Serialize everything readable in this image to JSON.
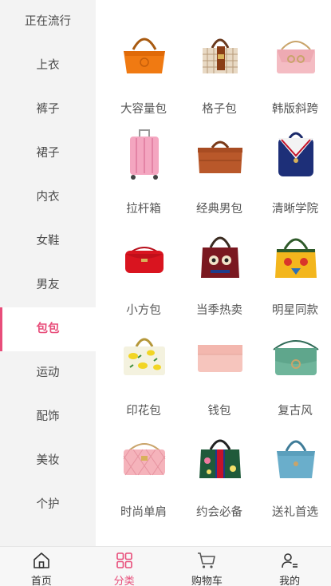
{
  "sidebar": {
    "items": [
      {
        "label": "正在流行"
      },
      {
        "label": "上衣"
      },
      {
        "label": "裤子"
      },
      {
        "label": "裙子"
      },
      {
        "label": "内衣"
      },
      {
        "label": "女鞋"
      },
      {
        "label": "男友"
      },
      {
        "label": "包包"
      },
      {
        "label": "运动"
      },
      {
        "label": "配饰"
      },
      {
        "label": "美妆"
      },
      {
        "label": "个护"
      }
    ],
    "active_label": "包包"
  },
  "grid": {
    "items": [
      {
        "label": "大容量包",
        "icon": "orange-handbag-icon"
      },
      {
        "label": "格子包",
        "icon": "plaid-bag-icon"
      },
      {
        "label": "韩版斜跨",
        "icon": "pink-crossbody-bag-icon"
      },
      {
        "label": "拉杆箱",
        "icon": "pink-suitcase-icon"
      },
      {
        "label": "经典男包",
        "icon": "brown-briefcase-icon"
      },
      {
        "label": "清晰学院",
        "icon": "navy-backpack-icon"
      },
      {
        "label": "小方包",
        "icon": "red-shoulder-bag-icon"
      },
      {
        "label": "当季热卖",
        "icon": "patterned-handbag-icon"
      },
      {
        "label": "明星同款",
        "icon": "yellow-embroidered-bag-icon"
      },
      {
        "label": "印花包",
        "icon": "lemon-print-bag-icon"
      },
      {
        "label": "钱包",
        "icon": "pink-wallet-icon"
      },
      {
        "label": "复古风",
        "icon": "green-saddle-bag-icon"
      },
      {
        "label": "时尚单肩",
        "icon": "quilted-pink-bag-icon"
      },
      {
        "label": "约会必备",
        "icon": "floral-green-bag-icon"
      },
      {
        "label": "送礼首选",
        "icon": "blue-tote-bag-icon"
      }
    ]
  },
  "tabbar": {
    "tabs": [
      {
        "label": "首页",
        "icon": "home-icon"
      },
      {
        "label": "分类",
        "icon": "category-grid-icon"
      },
      {
        "label": "购物车",
        "icon": "cart-icon"
      },
      {
        "label": "我的",
        "icon": "user-icon"
      }
    ],
    "active_label": "分类"
  },
  "colors": {
    "accent": "#e84d7a",
    "sidebar_bg": "#f3f3f3",
    "tabbar_bg": "#f7f7f7"
  }
}
